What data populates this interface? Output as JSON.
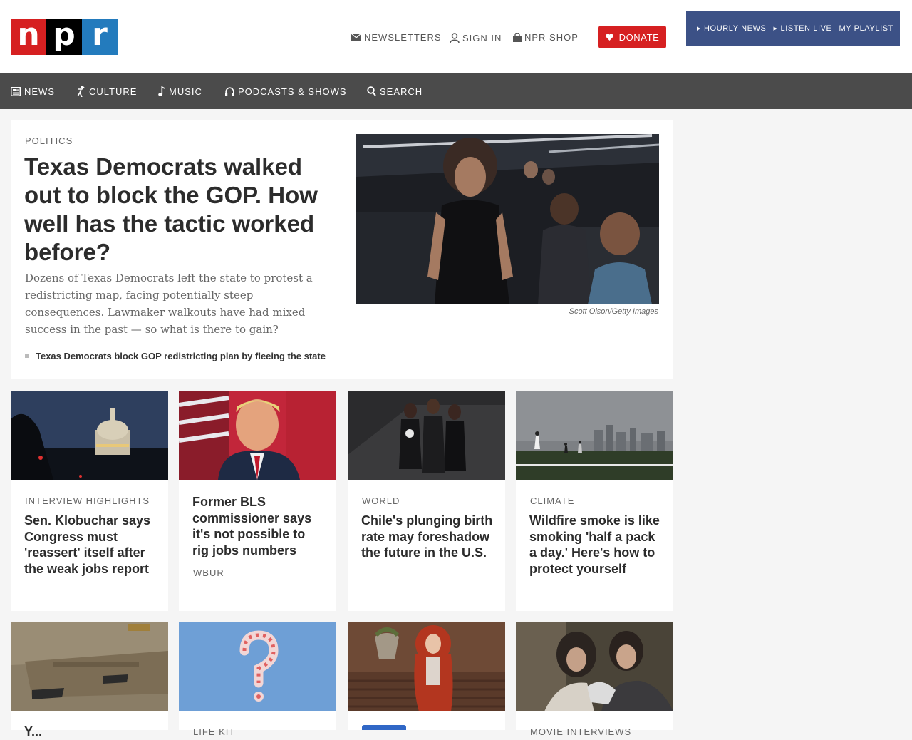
{
  "brand": {
    "letters": [
      "n",
      "p",
      "r"
    ],
    "colors": {
      "n": "#d62021",
      "p": "#000000",
      "r": "#237bbd"
    }
  },
  "header": {
    "newsletters": "NEWSLETTERS",
    "sign_in": "SIGN IN",
    "shop": "NPR SHOP",
    "donate": "DONATE",
    "player": {
      "hourly_news": "HOURLY NEWS",
      "listen_live": "LISTEN LIVE",
      "my_playlist": "MY PLAYLIST"
    }
  },
  "nav": [
    {
      "label": "NEWS",
      "icon": "newspaper-icon"
    },
    {
      "label": "CULTURE",
      "icon": "dancer-icon"
    },
    {
      "label": "MUSIC",
      "icon": "music-note-icon"
    },
    {
      "label": "PODCASTS & SHOWS",
      "icon": "headphones-icon"
    },
    {
      "label": "SEARCH",
      "icon": "search-icon"
    }
  ],
  "hero": {
    "kicker": "POLITICS",
    "title": "Texas Democrats walked out to block the GOP. How well has the tactic worked before?",
    "teaser": "Dozens of Texas Democrats left the state to protest a redistricting map, facing potentially steep consequences. Lawmaker walkouts have had mixed success in the past — so what is there to gain?",
    "credit": "Scott Olson/Getty Images",
    "related": "Texas Democrats block GOP redistricting plan by fleeing the state"
  },
  "cards": [
    {
      "kicker": "INTERVIEW HIGHLIGHTS",
      "title": "Sen. Klobuchar says Congress must 'reassert' itself after the weak jobs report"
    },
    {
      "title": "Former BLS commissioner says it's not possible to rig jobs numbers",
      "source": "WBUR"
    },
    {
      "kicker": "WORLD",
      "title": "Chile's plunging birth rate may foreshadow the future in the U.S."
    },
    {
      "kicker": "CLIMATE",
      "title": "Wildfire smoke is like smoking 'half a pack a day.' Here's how to protect yourself"
    }
  ],
  "bottom_cards": [
    {
      "title": "Y...",
      "kicker": ""
    },
    {
      "kicker": "LIFE KIT"
    },
    {
      "kicker": ""
    },
    {
      "kicker": "MOVIE INTERVIEWS"
    }
  ]
}
